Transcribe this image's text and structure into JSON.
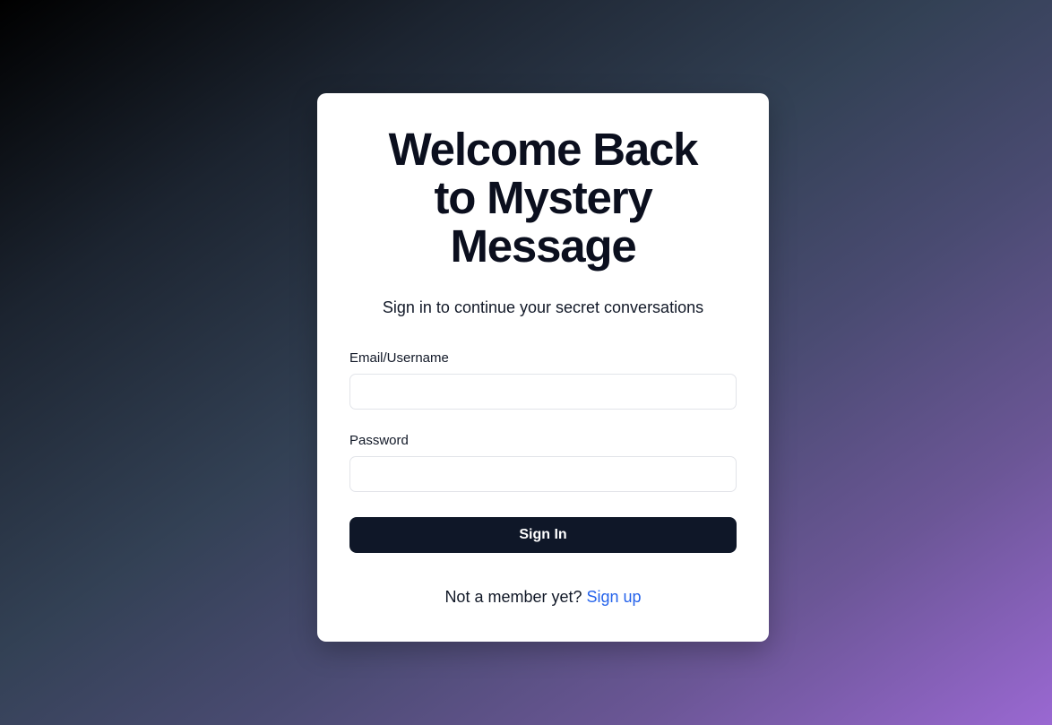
{
  "login": {
    "title_lines": [
      "Welcome Back",
      "to Mystery",
      "Message"
    ],
    "subtitle": "Sign in to continue your secret conversations",
    "email": {
      "label": "Email/Username",
      "value": "",
      "placeholder": ""
    },
    "password": {
      "label": "Password",
      "value": "",
      "placeholder": ""
    },
    "submit_label": "Sign In",
    "footer_text": "Not a member yet? ",
    "signup_link": "Sign up"
  },
  "colors": {
    "card_background": "#ffffff",
    "heading": "#0b0f1e",
    "button_background": "#0f1728",
    "button_text": "#ffffff",
    "link": "#2563eb",
    "input_border": "#e2e4e9",
    "background_gradient": [
      "#000000",
      "#334155",
      "#9a68d2"
    ]
  }
}
